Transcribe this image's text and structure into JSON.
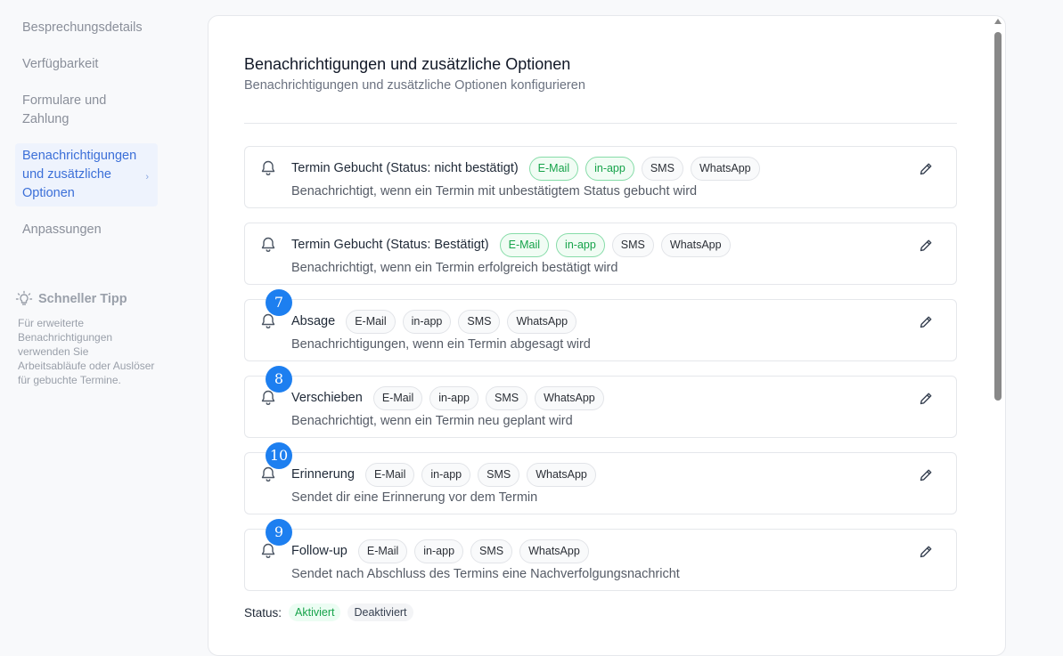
{
  "sidebar": {
    "items": [
      {
        "label": "Besprechungsdetails"
      },
      {
        "label": "Verfügbarkeit"
      },
      {
        "label": "Formulare und Zahlung"
      },
      {
        "label": "Benachrichtigungen und zusätzliche Optionen",
        "active": true
      },
      {
        "label": "Anpassungen"
      }
    ],
    "chevron": "›",
    "tip": {
      "title": "Schneller Tipp",
      "icon": "lightbulb-icon",
      "text": "Für erweiterte Benachrichtigungen verwenden Sie Arbeitsabläufe oder Auslöser für gebuchte Termine."
    }
  },
  "main": {
    "title": "Benachrichtigungen und zusätzliche Optionen",
    "subtitle": "Benachrichtigungen und zusätzliche Optionen konfigurieren",
    "cards": [
      {
        "title": "Termin Gebucht (Status: nicht bestätigt)",
        "description": "Benachrichtigt, wenn ein Termin mit unbestätigtem Status gebucht wird",
        "channels": [
          {
            "label": "E-Mail",
            "active": true
          },
          {
            "label": "in-app",
            "active": true
          },
          {
            "label": "SMS",
            "active": false
          },
          {
            "label": "WhatsApp",
            "active": false
          }
        ],
        "badge": ""
      },
      {
        "title": "Termin Gebucht (Status: Bestätigt)",
        "description": "Benachrichtigt, wenn ein Termin erfolgreich bestätigt wird",
        "channels": [
          {
            "label": "E-Mail",
            "active": true
          },
          {
            "label": "in-app",
            "active": true
          },
          {
            "label": "SMS",
            "active": false
          },
          {
            "label": "WhatsApp",
            "active": false
          }
        ],
        "badge": ""
      },
      {
        "title": "Absage",
        "description": "Benachrichtigungen, wenn ein Termin abgesagt wird",
        "channels": [
          {
            "label": "E-Mail",
            "active": false
          },
          {
            "label": "in-app",
            "active": false
          },
          {
            "label": "SMS",
            "active": false
          },
          {
            "label": "WhatsApp",
            "active": false
          }
        ],
        "badge": "7"
      },
      {
        "title": "Verschieben",
        "description": "Benachrichtigt, wenn ein Termin neu geplant wird",
        "channels": [
          {
            "label": "E-Mail",
            "active": false
          },
          {
            "label": "in-app",
            "active": false
          },
          {
            "label": "SMS",
            "active": false
          },
          {
            "label": "WhatsApp",
            "active": false
          }
        ],
        "badge": "8"
      },
      {
        "title": "Erinnerung",
        "description": "Sendet dir eine Erinnerung vor dem Termin",
        "channels": [
          {
            "label": "E-Mail",
            "active": false
          },
          {
            "label": "in-app",
            "active": false
          },
          {
            "label": "SMS",
            "active": false
          },
          {
            "label": "WhatsApp",
            "active": false
          }
        ],
        "badge": "10"
      },
      {
        "title": "Follow-up",
        "description": "Sendet nach Abschluss des Termins eine Nachverfolgungsnachricht",
        "channels": [
          {
            "label": "E-Mail",
            "active": false
          },
          {
            "label": "in-app",
            "active": false
          },
          {
            "label": "SMS",
            "active": false
          },
          {
            "label": "WhatsApp",
            "active": false
          }
        ],
        "badge": "9"
      }
    ],
    "status": {
      "label": "Status:",
      "active_label": "Aktiviert",
      "inactive_label": "Deaktiviert"
    }
  },
  "colors": {
    "accent": "#3b6fd8",
    "active_chip": "#16a34a",
    "badge": "#1d7ff0"
  }
}
